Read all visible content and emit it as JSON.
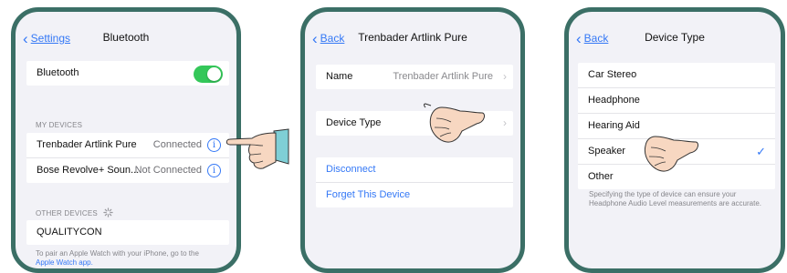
{
  "panel1": {
    "back": "Settings",
    "title": "Bluetooth",
    "bluetooth_label": "Bluetooth",
    "bluetooth_on": true,
    "my_devices_header": "MY DEVICES",
    "my_devices": [
      {
        "name": "Trenbader Artlink Pure",
        "status": "Connected"
      },
      {
        "name": "Bose Revolve+ Soun...",
        "status": "Not Connected"
      }
    ],
    "other_devices_header": "OTHER DEVICES",
    "other_devices": [
      {
        "name": "QUALITYCON"
      }
    ],
    "footer_text": "To pair an Apple Watch with your iPhone, go to the",
    "footer_link": "Apple Watch app."
  },
  "panel2": {
    "back": "Back",
    "title": "Trenbader Artlink Pure",
    "name_label": "Name",
    "name_value": "Trenbader Artlink Pure",
    "device_type_label": "Device Type",
    "disconnect": "Disconnect",
    "forget": "Forget This Device"
  },
  "panel3": {
    "back": "Back",
    "title": "Device Type",
    "options": [
      "Car Stereo",
      "Headphone",
      "Hearing Aid",
      "Speaker",
      "Other"
    ],
    "selected": "Speaker",
    "footer": "Specifying the type of device can ensure your Headphone Audio Level measurements are accurate."
  },
  "colors": {
    "accent": "#3478f6",
    "toggle_on": "#34c759",
    "frame": "#3b6f66",
    "background": "#f2f2f7"
  },
  "icons": [
    "chevron-left-icon",
    "info-icon",
    "chevron-right-icon",
    "checkmark-icon",
    "spinner-icon",
    "pointing-hand-icon"
  ]
}
